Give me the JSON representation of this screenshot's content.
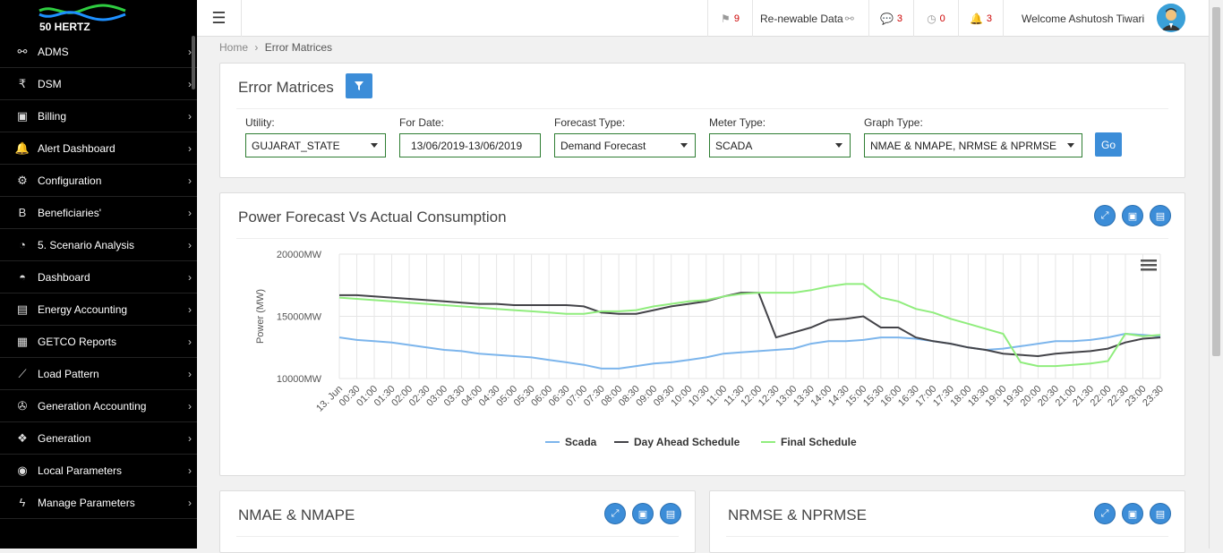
{
  "sidebar": {
    "logo_text": "50 HERTZ",
    "items": [
      {
        "label": "ADMS",
        "icon": "link-icon"
      },
      {
        "label": "DSM",
        "icon": "rupee-icon"
      },
      {
        "label": "Billing",
        "icon": "money-icon"
      },
      {
        "label": "Alert Dashboard",
        "icon": "bell-icon"
      },
      {
        "label": "Configuration",
        "icon": "gear-icon"
      },
      {
        "label": "Beneficiaries'",
        "icon": "bitcoin-icon"
      },
      {
        "label": "5. Scenario Analysis",
        "icon": "pie-chart-icon"
      },
      {
        "label": "Dashboard",
        "icon": "dashboard-icon"
      },
      {
        "label": "Energy Accounting",
        "icon": "excel-icon"
      },
      {
        "label": "GETCO Reports",
        "icon": "table-icon"
      },
      {
        "label": "Load Pattern",
        "icon": "line-chart-icon"
      },
      {
        "label": "Generation Accounting",
        "icon": "fan-icon"
      },
      {
        "label": "Generation",
        "icon": "cubes-icon"
      },
      {
        "label": "Local Parameters",
        "icon": "compass-icon"
      },
      {
        "label": "Manage Parameters",
        "icon": "bolt-icon"
      }
    ]
  },
  "topbar": {
    "flag_count": "9",
    "renewable_label": "Re-newable Data",
    "comments_count": "3",
    "clock_count": "0",
    "bell_count": "3",
    "welcome": "Welcome Ashutosh Tiwari"
  },
  "breadcrumb": {
    "home": "Home",
    "sep": "›",
    "current": "Error Matrices"
  },
  "filters": {
    "title": "Error Matrices",
    "utility_label": "Utility:",
    "utility_value": "GUJARAT_STATE",
    "date_label": "For Date:",
    "date_value": "13/06/2019-13/06/2019",
    "forecast_label": "Forecast Type:",
    "forecast_value": "Demand Forecast",
    "meter_label": "Meter Type:",
    "meter_value": "SCADA",
    "graph_label": "Graph Type:",
    "graph_value": "NMAE & NMAPE, NRMSE & NPRMSE",
    "go_label": "Go"
  },
  "chart_panel": {
    "title": "Power Forecast Vs Actual Consumption"
  },
  "bottom_panels": {
    "left_title": "NMAE & NMAPE",
    "right_title": "NRMSE & NPRMSE"
  },
  "chart_data": {
    "type": "line",
    "title": "",
    "ylabel": "Power (MW)",
    "xlabel": "",
    "ylim": [
      10000,
      20000
    ],
    "y_ticks": [
      "10000MW",
      "15000MW",
      "20000MW"
    ],
    "x": [
      "13. Jun",
      "00:30",
      "01:00",
      "01:30",
      "02:00",
      "02:30",
      "03:00",
      "03:30",
      "04:00",
      "04:30",
      "05:00",
      "05:30",
      "06:00",
      "06:30",
      "07:00",
      "07:30",
      "08:00",
      "08:30",
      "09:00",
      "09:30",
      "10:00",
      "10:30",
      "11:00",
      "11:30",
      "12:00",
      "12:30",
      "13:00",
      "13:30",
      "14:00",
      "14:30",
      "15:00",
      "15:30",
      "16:00",
      "16:30",
      "17:00",
      "17:30",
      "18:00",
      "18:30",
      "19:00",
      "19:30",
      "20:00",
      "20:30",
      "21:00",
      "21:30",
      "22:00",
      "22:30",
      "23:00",
      "23:30"
    ],
    "series": [
      {
        "name": "Scada",
        "color": "#7cb5ec",
        "values": [
          13300,
          13100,
          13000,
          12900,
          12700,
          12500,
          12300,
          12200,
          12000,
          11900,
          11800,
          11700,
          11500,
          11300,
          11100,
          10800,
          10800,
          11000,
          11200,
          11300,
          11500,
          11700,
          12000,
          12100,
          12200,
          12300,
          12400,
          12800,
          13000,
          13000,
          13100,
          13300,
          13300,
          13200,
          13000,
          12800,
          12500,
          12300,
          12400,
          12600,
          12800,
          13000,
          13000,
          13100,
          13300,
          13600,
          13500,
          13400
        ]
      },
      {
        "name": "Day Ahead Schedule",
        "color": "#434348",
        "values": [
          16700,
          16700,
          16600,
          16500,
          16400,
          16300,
          16200,
          16100,
          16000,
          16000,
          15900,
          15900,
          15900,
          15900,
          15800,
          15300,
          15200,
          15200,
          15500,
          15800,
          16000,
          16200,
          16600,
          16900,
          16900,
          13300,
          13700,
          14100,
          14700,
          14800,
          15000,
          14100,
          14100,
          13300,
          13000,
          12800,
          12500,
          12300,
          12000,
          11900,
          11800,
          12000,
          12100,
          12200,
          12400,
          12900,
          13200,
          13300
        ]
      },
      {
        "name": "Final Schedule",
        "color": "#90ed7d",
        "values": [
          16500,
          16400,
          16300,
          16200,
          16100,
          16000,
          15900,
          15800,
          15700,
          15600,
          15500,
          15400,
          15300,
          15200,
          15200,
          15400,
          15400,
          15500,
          15800,
          16000,
          16200,
          16300,
          16600,
          16800,
          16900,
          16900,
          16900,
          17100,
          17400,
          17600,
          17600,
          16500,
          16200,
          15600,
          15300,
          14800,
          14400,
          14000,
          13600,
          11300,
          11000,
          11000,
          11100,
          11200,
          11400,
          13600,
          13400,
          13500
        ]
      }
    ],
    "legend": [
      "Scada",
      "Day Ahead Schedule",
      "Final Schedule"
    ],
    "legend_position": "bottom-center",
    "grid": true
  }
}
